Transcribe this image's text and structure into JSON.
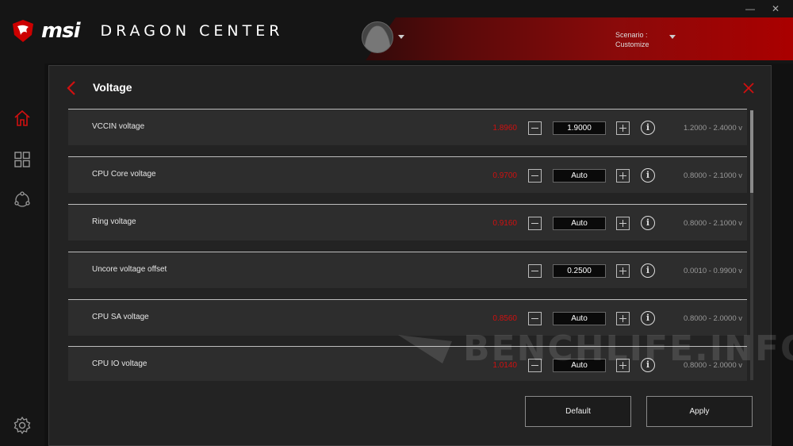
{
  "header": {
    "brand": "msi",
    "app_title": "DRAGON CENTER",
    "scenario_label": "Scenario :",
    "scenario_value": "Customize",
    "minimize": "—",
    "close": "✕"
  },
  "sidebar": {
    "items": [
      {
        "name": "home",
        "icon": "home-icon"
      },
      {
        "name": "apps",
        "icon": "grid-icon"
      },
      {
        "name": "connect",
        "icon": "share-icon"
      },
      {
        "name": "settings",
        "icon": "gear-icon"
      }
    ]
  },
  "panel": {
    "title": "Voltage",
    "rows": [
      {
        "label": "VCCIN voltage",
        "current": "1.8960",
        "value": "1.9000",
        "range": "1.2000 - 2.4000 v"
      },
      {
        "label": "CPU Core voltage",
        "current": "0.9700",
        "value": "Auto",
        "range": "0.8000 - 2.1000 v"
      },
      {
        "label": "Ring voltage",
        "current": "0.9160",
        "value": "Auto",
        "range": "0.8000 - 2.1000 v"
      },
      {
        "label": "Uncore voltage offset",
        "current": "",
        "value": "0.2500",
        "range": "0.0010 - 0.9900 v"
      },
      {
        "label": "CPU SA voltage",
        "current": "0.8560",
        "value": "Auto",
        "range": "0.8000 - 2.0000 v"
      },
      {
        "label": "CPU IO voltage",
        "current": "1.0140",
        "value": "Auto",
        "range": "0.8000 - 2.0000 v"
      }
    ],
    "default_label": "Default",
    "apply_label": "Apply"
  },
  "watermark": "BENCHLIFE.INFO",
  "colors": {
    "accent": "#d01010",
    "panel": "#232323",
    "row": "#2d2d2d"
  }
}
